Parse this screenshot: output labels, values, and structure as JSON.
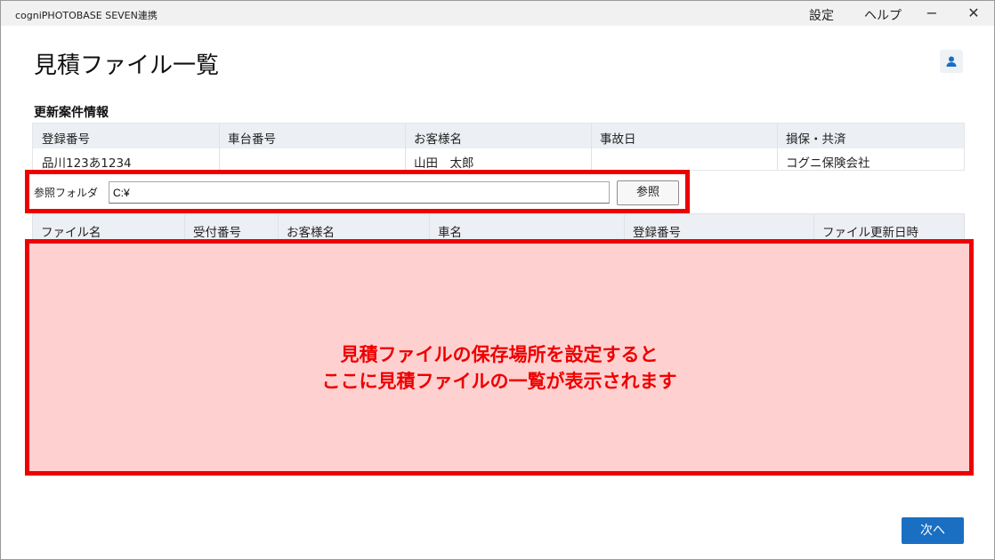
{
  "window": {
    "title": "cogniPHOTOBASE SEVEN連携",
    "menu": [
      "設定",
      "ヘルプ"
    ],
    "controls": {
      "minimize": "−",
      "close": "✕"
    }
  },
  "page": {
    "title": "見積ファイル一覧",
    "user_icon": "person-icon"
  },
  "case_info": {
    "section_title": "更新案件情報",
    "headers": [
      "登録番号",
      "車台番号",
      "お客様名",
      "事故日",
      "損保・共済"
    ],
    "values": [
      "品川123あ1234",
      "",
      "山田　太郎",
      "",
      "コグニ保険会社"
    ]
  },
  "folder": {
    "label": "参照フォルダ",
    "value": "C:¥",
    "browse_label": "参照"
  },
  "file_list": {
    "headers": [
      "ファイル名",
      "受付番号",
      "お客様名",
      "車名",
      "登録番号",
      "ファイル更新日時"
    ],
    "rows": [],
    "empty_message_line1": "見積ファイルの保存場所を設定すると",
    "empty_message_line2": "ここに見積ファイルの一覧が表示されます"
  },
  "footer": {
    "next_label": "次へ"
  },
  "colors": {
    "accent": "#1a6fc2",
    "highlight_border": "#ee0000",
    "highlight_fill": "#ffd0d0",
    "header_bg": "#eceff3"
  }
}
